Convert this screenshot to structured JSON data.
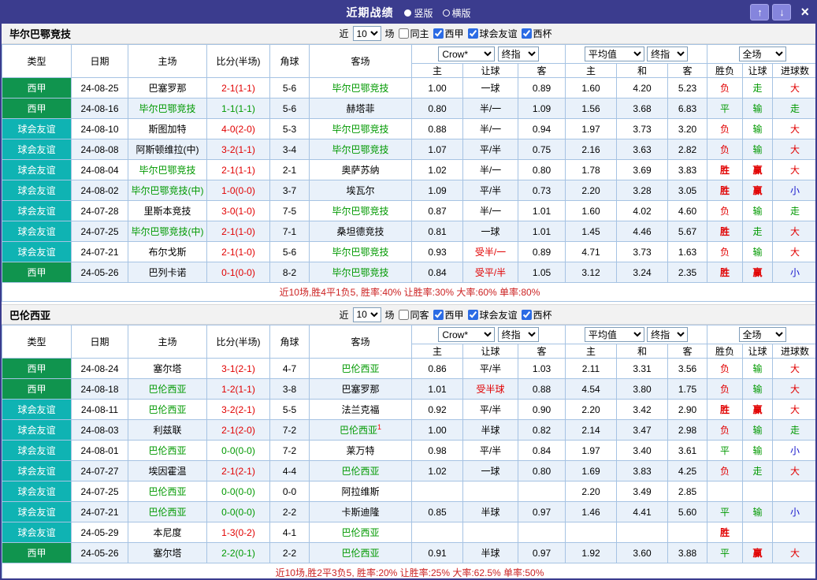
{
  "title_bar": {
    "title": "近期战绩",
    "radio_vertical": "竖版",
    "radio_horizontal": "横版"
  },
  "icons": {
    "up": "↑",
    "down": "↓",
    "close": "×"
  },
  "filters": {
    "near_label": "近",
    "count": "10",
    "count_suffix": "场",
    "leagues": [
      "西甲",
      "球会友谊",
      "西杯"
    ]
  },
  "header": {
    "col_type": "类型",
    "col_date": "日期",
    "col_home": "主场",
    "col_score": "比分(半场)",
    "col_corner": "角球",
    "col_away": "客场",
    "sel_crow": "Crow*",
    "sel_final": "终指",
    "sel_avg": "平均值",
    "sel_full": "全场",
    "sub": [
      "主",
      "让球",
      "客",
      "主",
      "和",
      "客",
      "胜负",
      "让球",
      "进球数"
    ]
  },
  "sections": [
    {
      "team": "毕尔巴鄂竞技",
      "same_venue_label": "同主",
      "summary": "近10场,胜4平1负5, 胜率:40% 让胜率:30% 大率:60% 单率:80%",
      "rows": [
        [
          {
            "t": "西甲",
            "c": "tag-liga"
          },
          {
            "t": "24-08-25"
          },
          {
            "t": "巴塞罗那"
          },
          {
            "t": "2-1(1-1)",
            "c": "r"
          },
          {
            "t": "5-6"
          },
          {
            "t": "毕尔巴鄂竞技",
            "c": "team"
          },
          {
            "t": "1.00"
          },
          {
            "t": "一球"
          },
          {
            "t": "0.89"
          },
          {
            "t": "1.60"
          },
          {
            "t": "4.20"
          },
          {
            "t": "5.23"
          },
          {
            "t": "负",
            "c": "r"
          },
          {
            "t": "走",
            "c": "g"
          },
          {
            "t": "大",
            "c": "r"
          }
        ],
        [
          {
            "t": "西甲",
            "c": "tag-liga"
          },
          {
            "t": "24-08-16"
          },
          {
            "t": "毕尔巴鄂竞技",
            "c": "team"
          },
          {
            "t": "1-1(1-1)",
            "c": "g"
          },
          {
            "t": "5-6"
          },
          {
            "t": "赫塔菲"
          },
          {
            "t": "0.80"
          },
          {
            "t": "半/一"
          },
          {
            "t": "1.09"
          },
          {
            "t": "1.56"
          },
          {
            "t": "3.68"
          },
          {
            "t": "6.83"
          },
          {
            "t": "平",
            "c": "g"
          },
          {
            "t": "输",
            "c": "g"
          },
          {
            "t": "走",
            "c": "g"
          }
        ],
        [
          {
            "t": "球会友谊",
            "c": "tag-fr"
          },
          {
            "t": "24-08-10"
          },
          {
            "t": "斯图加特"
          },
          {
            "t": "4-0(2-0)",
            "c": "r"
          },
          {
            "t": "5-3"
          },
          {
            "t": "毕尔巴鄂竞技",
            "c": "team"
          },
          {
            "t": "0.88"
          },
          {
            "t": "半/一"
          },
          {
            "t": "0.94"
          },
          {
            "t": "1.97"
          },
          {
            "t": "3.73"
          },
          {
            "t": "3.20"
          },
          {
            "t": "负",
            "c": "r"
          },
          {
            "t": "输",
            "c": "g"
          },
          {
            "t": "大",
            "c": "r"
          }
        ],
        [
          {
            "t": "球会友谊",
            "c": "tag-fr"
          },
          {
            "t": "24-08-08"
          },
          {
            "t": "阿斯顿维拉(中)"
          },
          {
            "t": "3-2(1-1)",
            "c": "r"
          },
          {
            "t": "3-4"
          },
          {
            "t": "毕尔巴鄂竞技",
            "c": "team"
          },
          {
            "t": "1.07"
          },
          {
            "t": "平/半"
          },
          {
            "t": "0.75"
          },
          {
            "t": "2.16"
          },
          {
            "t": "3.63"
          },
          {
            "t": "2.82"
          },
          {
            "t": "负",
            "c": "r"
          },
          {
            "t": "输",
            "c": "g"
          },
          {
            "t": "大",
            "c": "r"
          }
        ],
        [
          {
            "t": "球会友谊",
            "c": "tag-fr"
          },
          {
            "t": "24-08-04"
          },
          {
            "t": "毕尔巴鄂竞技",
            "c": "team"
          },
          {
            "t": "2-1(1-1)",
            "c": "r"
          },
          {
            "t": "2-1"
          },
          {
            "t": "奥萨苏纳"
          },
          {
            "t": "1.02"
          },
          {
            "t": "半/一"
          },
          {
            "t": "0.80"
          },
          {
            "t": "1.78"
          },
          {
            "t": "3.69"
          },
          {
            "t": "3.83"
          },
          {
            "t": "胜",
            "c": "rb"
          },
          {
            "t": "赢",
            "c": "rb"
          },
          {
            "t": "大",
            "c": "r"
          }
        ],
        [
          {
            "t": "球会友谊",
            "c": "tag-fr"
          },
          {
            "t": "24-08-02"
          },
          {
            "t": "毕尔巴鄂竞技(中)",
            "c": "team"
          },
          {
            "t": "1-0(0-0)",
            "c": "r"
          },
          {
            "t": "3-7"
          },
          {
            "t": "埃瓦尔"
          },
          {
            "t": "1.09"
          },
          {
            "t": "平/半"
          },
          {
            "t": "0.73"
          },
          {
            "t": "2.20"
          },
          {
            "t": "3.28"
          },
          {
            "t": "3.05"
          },
          {
            "t": "胜",
            "c": "rb"
          },
          {
            "t": "赢",
            "c": "rb"
          },
          {
            "t": "小",
            "c": "b"
          }
        ],
        [
          {
            "t": "球会友谊",
            "c": "tag-fr"
          },
          {
            "t": "24-07-28"
          },
          {
            "t": "里斯本竞技"
          },
          {
            "t": "3-0(1-0)",
            "c": "r"
          },
          {
            "t": "7-5"
          },
          {
            "t": "毕尔巴鄂竞技",
            "c": "team"
          },
          {
            "t": "0.87"
          },
          {
            "t": "半/一"
          },
          {
            "t": "1.01"
          },
          {
            "t": "1.60"
          },
          {
            "t": "4.02"
          },
          {
            "t": "4.60"
          },
          {
            "t": "负",
            "c": "r"
          },
          {
            "t": "输",
            "c": "g"
          },
          {
            "t": "走",
            "c": "g"
          }
        ],
        [
          {
            "t": "球会友谊",
            "c": "tag-fr"
          },
          {
            "t": "24-07-25"
          },
          {
            "t": "毕尔巴鄂竞技(中)",
            "c": "team"
          },
          {
            "t": "2-1(1-0)",
            "c": "r"
          },
          {
            "t": "7-1"
          },
          {
            "t": "桑坦德竞技"
          },
          {
            "t": "0.81"
          },
          {
            "t": "一球"
          },
          {
            "t": "1.01"
          },
          {
            "t": "1.45"
          },
          {
            "t": "4.46"
          },
          {
            "t": "5.67"
          },
          {
            "t": "胜",
            "c": "rb"
          },
          {
            "t": "走",
            "c": "g"
          },
          {
            "t": "大",
            "c": "r"
          }
        ],
        [
          {
            "t": "球会友谊",
            "c": "tag-fr"
          },
          {
            "t": "24-07-21"
          },
          {
            "t": "布尔戈斯"
          },
          {
            "t": "2-1(1-0)",
            "c": "r"
          },
          {
            "t": "5-6"
          },
          {
            "t": "毕尔巴鄂竞技",
            "c": "team"
          },
          {
            "t": "0.93"
          },
          {
            "t": "受半/一",
            "c": "r"
          },
          {
            "t": "0.89"
          },
          {
            "t": "4.71"
          },
          {
            "t": "3.73"
          },
          {
            "t": "1.63"
          },
          {
            "t": "负",
            "c": "r"
          },
          {
            "t": "输",
            "c": "g"
          },
          {
            "t": "大",
            "c": "r"
          }
        ],
        [
          {
            "t": "西甲",
            "c": "tag-liga"
          },
          {
            "t": "24-05-26"
          },
          {
            "t": "巴列卡诺"
          },
          {
            "t": "0-1(0-0)",
            "c": "r"
          },
          {
            "t": "8-2"
          },
          {
            "t": "毕尔巴鄂竞技",
            "c": "team"
          },
          {
            "t": "0.84"
          },
          {
            "t": "受平/半",
            "c": "r"
          },
          {
            "t": "1.05"
          },
          {
            "t": "3.12"
          },
          {
            "t": "3.24"
          },
          {
            "t": "2.35"
          },
          {
            "t": "胜",
            "c": "rb"
          },
          {
            "t": "赢",
            "c": "rb"
          },
          {
            "t": "小",
            "c": "b"
          }
        ]
      ]
    },
    {
      "team": "巴伦西亚",
      "same_venue_label": "同客",
      "summary": "近10场,胜2平3负5, 胜率:20% 让胜率:25% 大率:62.5% 单率:50%",
      "rows": [
        [
          {
            "t": "西甲",
            "c": "tag-liga"
          },
          {
            "t": "24-08-24"
          },
          {
            "t": "塞尔塔"
          },
          {
            "t": "3-1(2-1)",
            "c": "r"
          },
          {
            "t": "4-7"
          },
          {
            "t": "巴伦西亚",
            "c": "team"
          },
          {
            "t": "0.86"
          },
          {
            "t": "平/半"
          },
          {
            "t": "1.03"
          },
          {
            "t": "2.11"
          },
          {
            "t": "3.31"
          },
          {
            "t": "3.56"
          },
          {
            "t": "负",
            "c": "r"
          },
          {
            "t": "输",
            "c": "g"
          },
          {
            "t": "大",
            "c": "r"
          }
        ],
        [
          {
            "t": "西甲",
            "c": "tag-liga"
          },
          {
            "t": "24-08-18"
          },
          {
            "t": "巴伦西亚",
            "c": "team"
          },
          {
            "t": "1-2(1-1)",
            "c": "r"
          },
          {
            "t": "3-8"
          },
          {
            "t": "巴塞罗那"
          },
          {
            "t": "1.01"
          },
          {
            "t": "受半球",
            "c": "r"
          },
          {
            "t": "0.88"
          },
          {
            "t": "4.54"
          },
          {
            "t": "3.80"
          },
          {
            "t": "1.75"
          },
          {
            "t": "负",
            "c": "r"
          },
          {
            "t": "输",
            "c": "g"
          },
          {
            "t": "大",
            "c": "r"
          }
        ],
        [
          {
            "t": "球会友谊",
            "c": "tag-fr"
          },
          {
            "t": "24-08-11"
          },
          {
            "t": "巴伦西亚",
            "c": "team"
          },
          {
            "t": "3-2(2-1)",
            "c": "r"
          },
          {
            "t": "5-5"
          },
          {
            "t": "法兰克福"
          },
          {
            "t": "0.92"
          },
          {
            "t": "平/半"
          },
          {
            "t": "0.90"
          },
          {
            "t": "2.20"
          },
          {
            "t": "3.42"
          },
          {
            "t": "2.90"
          },
          {
            "t": "胜",
            "c": "rb"
          },
          {
            "t": "赢",
            "c": "rb"
          },
          {
            "t": "大",
            "c": "r"
          }
        ],
        [
          {
            "t": "球会友谊",
            "c": "tag-fr"
          },
          {
            "t": "24-08-03"
          },
          {
            "t": "利兹联"
          },
          {
            "t": "2-1(2-0)",
            "c": "r"
          },
          {
            "t": "7-2"
          },
          {
            "t": "巴伦西亚",
            "c": "team",
            "s": "1"
          },
          {
            "t": "1.00"
          },
          {
            "t": "半球"
          },
          {
            "t": "0.82"
          },
          {
            "t": "2.14"
          },
          {
            "t": "3.47"
          },
          {
            "t": "2.98"
          },
          {
            "t": "负",
            "c": "r"
          },
          {
            "t": "输",
            "c": "g"
          },
          {
            "t": "走",
            "c": "g"
          }
        ],
        [
          {
            "t": "球会友谊",
            "c": "tag-fr"
          },
          {
            "t": "24-08-01"
          },
          {
            "t": "巴伦西亚",
            "c": "team"
          },
          {
            "t": "0-0(0-0)",
            "c": "g"
          },
          {
            "t": "7-2"
          },
          {
            "t": "莱万特"
          },
          {
            "t": "0.98"
          },
          {
            "t": "平/半"
          },
          {
            "t": "0.84"
          },
          {
            "t": "1.97"
          },
          {
            "t": "3.40"
          },
          {
            "t": "3.61"
          },
          {
            "t": "平",
            "c": "g"
          },
          {
            "t": "输",
            "c": "g"
          },
          {
            "t": "小",
            "c": "b"
          }
        ],
        [
          {
            "t": "球会友谊",
            "c": "tag-fr"
          },
          {
            "t": "24-07-27"
          },
          {
            "t": "埃因霍温"
          },
          {
            "t": "2-1(2-1)",
            "c": "r"
          },
          {
            "t": "4-4"
          },
          {
            "t": "巴伦西亚",
            "c": "team"
          },
          {
            "t": "1.02"
          },
          {
            "t": "一球"
          },
          {
            "t": "0.80"
          },
          {
            "t": "1.69"
          },
          {
            "t": "3.83"
          },
          {
            "t": "4.25"
          },
          {
            "t": "负",
            "c": "r"
          },
          {
            "t": "走",
            "c": "g"
          },
          {
            "t": "大",
            "c": "r"
          }
        ],
        [
          {
            "t": "球会友谊",
            "c": "tag-fr"
          },
          {
            "t": "24-07-25"
          },
          {
            "t": "巴伦西亚",
            "c": "team"
          },
          {
            "t": "0-0(0-0)",
            "c": "g"
          },
          {
            "t": "0-0"
          },
          {
            "t": "阿拉维斯"
          },
          {
            "t": ""
          },
          {
            "t": ""
          },
          {
            "t": ""
          },
          {
            "t": "2.20"
          },
          {
            "t": "3.49"
          },
          {
            "t": "2.85"
          },
          {
            "t": ""
          },
          {
            "t": ""
          },
          {
            "t": ""
          }
        ],
        [
          {
            "t": "球会友谊",
            "c": "tag-fr"
          },
          {
            "t": "24-07-21"
          },
          {
            "t": "巴伦西亚",
            "c": "team"
          },
          {
            "t": "0-0(0-0)",
            "c": "g"
          },
          {
            "t": "2-2"
          },
          {
            "t": "卡斯迪隆"
          },
          {
            "t": "0.85"
          },
          {
            "t": "半球"
          },
          {
            "t": "0.97"
          },
          {
            "t": "1.46"
          },
          {
            "t": "4.41"
          },
          {
            "t": "5.60"
          },
          {
            "t": "平",
            "c": "g"
          },
          {
            "t": "输",
            "c": "g"
          },
          {
            "t": "小",
            "c": "b"
          }
        ],
        [
          {
            "t": "球会友谊",
            "c": "tag-fr"
          },
          {
            "t": "24-05-29"
          },
          {
            "t": "本尼度"
          },
          {
            "t": "1-3(0-2)",
            "c": "r"
          },
          {
            "t": "4-1"
          },
          {
            "t": "巴伦西亚",
            "c": "team"
          },
          {
            "t": ""
          },
          {
            "t": ""
          },
          {
            "t": ""
          },
          {
            "t": ""
          },
          {
            "t": ""
          },
          {
            "t": ""
          },
          {
            "t": "胜",
            "c": "rb"
          },
          {
            "t": ""
          },
          {
            "t": ""
          }
        ],
        [
          {
            "t": "西甲",
            "c": "tag-liga"
          },
          {
            "t": "24-05-26"
          },
          {
            "t": "塞尔塔"
          },
          {
            "t": "2-2(0-1)",
            "c": "g"
          },
          {
            "t": "2-2"
          },
          {
            "t": "巴伦西亚",
            "c": "team"
          },
          {
            "t": "0.91"
          },
          {
            "t": "半球"
          },
          {
            "t": "0.97"
          },
          {
            "t": "1.92"
          },
          {
            "t": "3.60"
          },
          {
            "t": "3.88"
          },
          {
            "t": "平",
            "c": "g"
          },
          {
            "t": "赢",
            "c": "rb"
          },
          {
            "t": "大",
            "c": "r"
          }
        ]
      ]
    }
  ]
}
